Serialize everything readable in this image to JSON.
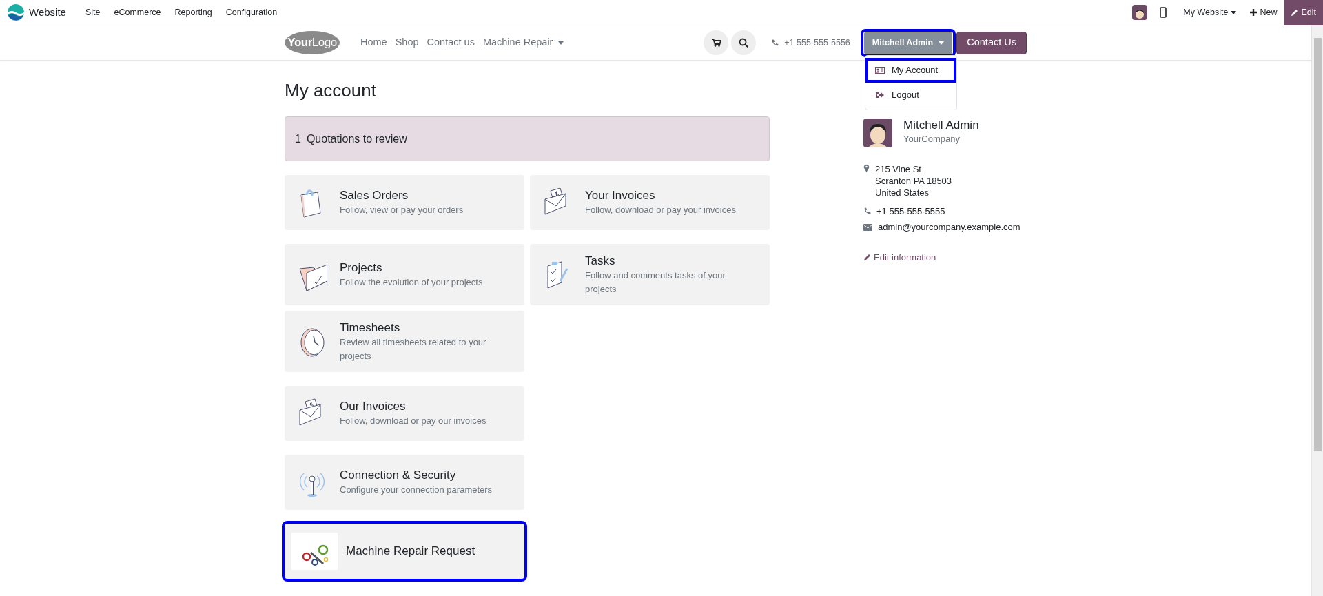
{
  "admin_bar": {
    "app_name": "Website",
    "menu": [
      "Site",
      "eCommerce",
      "Reporting",
      "Configuration"
    ],
    "website_switcher": "My Website",
    "new_button": "New",
    "edit_button": "Edit"
  },
  "header": {
    "logo": "**Your**Logo",
    "nav": [
      {
        "label": "Home",
        "dropdown": false
      },
      {
        "label": "Shop",
        "dropdown": false
      },
      {
        "label": "Contact us",
        "dropdown": false
      },
      {
        "label": "Machine Repair",
        "dropdown": true
      }
    ],
    "phone": "+1 555-555-5556",
    "user_menu": {
      "label": "Mitchell Admin",
      "expanded": true,
      "highlighted": true,
      "items": [
        {
          "label": "My Account",
          "highlighted": true
        },
        {
          "label": "Logout",
          "highlighted": false
        }
      ]
    },
    "contact_button": "Contact Us"
  },
  "page_title": "My account",
  "alert": {
    "count": "1",
    "text": "Quotations to review"
  },
  "sections": [
    {
      "cards": [
        {
          "kind": "icon",
          "title": "Sales Orders",
          "description": "Follow, view or pay your orders",
          "highlighted": false
        },
        {
          "kind": "icon",
          "title": "Your Invoices",
          "description": "Follow, download or pay your invoices",
          "highlighted": false
        }
      ]
    },
    {
      "cards": [
        {
          "kind": "icon",
          "title": "Projects",
          "description": "Follow the evolution of your projects",
          "highlighted": false
        },
        {
          "kind": "icon",
          "title": "Tasks",
          "description": "Follow and comments tasks of your projects",
          "highlighted": false
        },
        {
          "kind": "icon",
          "title": "Timesheets",
          "description": "Review all timesheets related to your projects",
          "highlighted": false
        }
      ]
    },
    {
      "cards": [
        {
          "kind": "icon",
          "title": "Our Invoices",
          "description": "Follow, download or pay our invoices",
          "highlighted": false
        }
      ]
    },
    {
      "cards": [
        {
          "kind": "icon",
          "title": "Connection & Security",
          "description": "Configure your connection parameters",
          "highlighted": false
        }
      ]
    },
    {
      "cards": [
        {
          "kind": "picture",
          "title": "Machine Repair Request",
          "highlighted": true
        }
      ]
    }
  ],
  "profile": {
    "name": "Mitchell Admin",
    "company": "YourCompany",
    "address": [
      "215 Vine St",
      "Scranton PA 18503",
      "United States"
    ],
    "phone": "+1 555-555-5555",
    "email": "admin@yourcompany.example.com",
    "edit_link": "Edit information"
  }
}
